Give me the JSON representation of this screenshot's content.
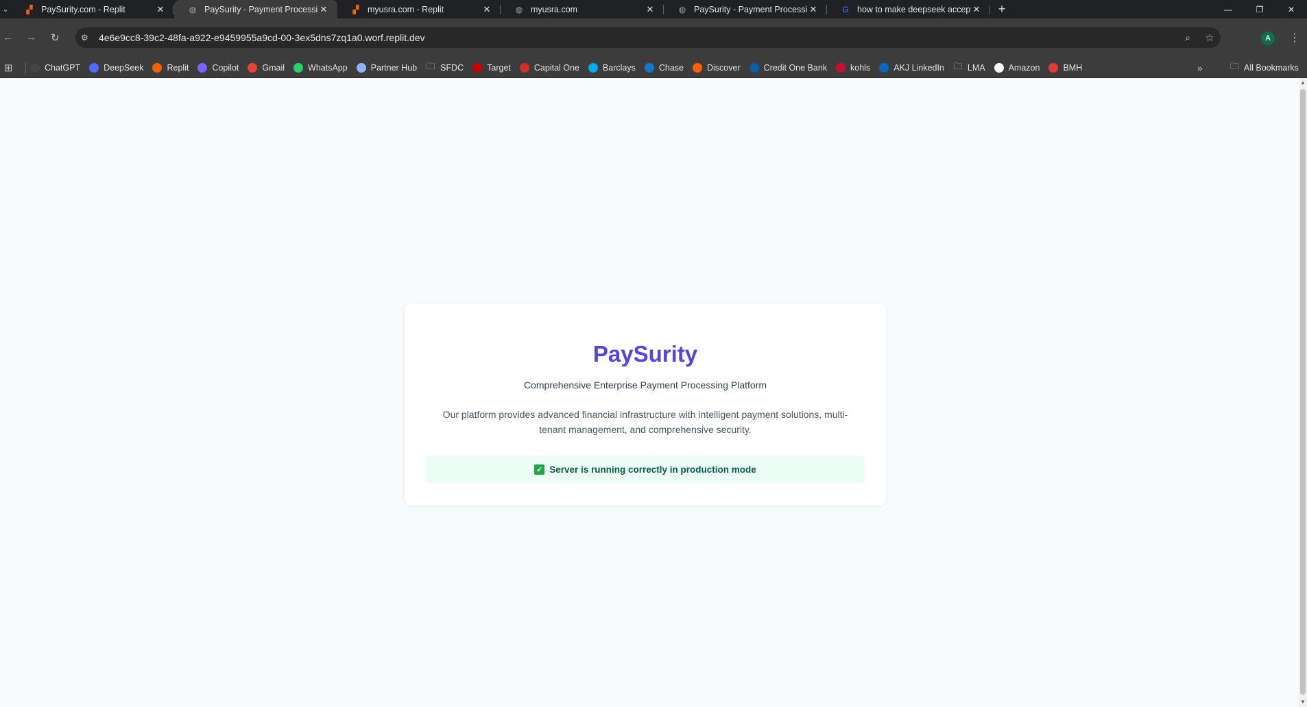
{
  "tabs": [
    {
      "title": "PaySurity.com - Replit",
      "icon": "replit-icon",
      "active": false
    },
    {
      "title": "PaySurity - Payment Processing",
      "icon": "globe-icon",
      "active": true
    },
    {
      "title": "myusra.com - Replit",
      "icon": "replit-icon",
      "active": false
    },
    {
      "title": "myusra.com",
      "icon": "globe-icon",
      "active": false
    },
    {
      "title": "PaySurity - Payment Processing",
      "icon": "globe-icon",
      "active": false
    },
    {
      "title": "how to make deepseek accept a",
      "icon": "google-icon",
      "active": false
    }
  ],
  "toolbar": {
    "url": "4e6e9cc8-39c2-48fa-a922-e9459955a9cd-00-3ex5dns7zq1a0.worf.replit.dev",
    "avatar_letter": "A"
  },
  "bookmarks": [
    {
      "label": "ChatGPT",
      "icon": "chatgpt-icon",
      "color": "#444444"
    },
    {
      "label": "DeepSeek",
      "icon": "deepseek-icon",
      "color": "#4d6bfe"
    },
    {
      "label": "Replit",
      "icon": "replit-icon",
      "color": "#f26207"
    },
    {
      "label": "Copilot",
      "icon": "copilot-icon",
      "color": "#7b61ff"
    },
    {
      "label": "Gmail",
      "icon": "gmail-icon",
      "color": "#ea4335"
    },
    {
      "label": "WhatsApp",
      "icon": "whatsapp-icon",
      "color": "#25d366"
    },
    {
      "label": "Partner Hub",
      "icon": "partner-hub-icon",
      "color": "#8ab4f8"
    },
    {
      "label": "SFDC",
      "icon": "folder-icon",
      "color": "#3c3c3c"
    },
    {
      "label": "Target",
      "icon": "target-icon",
      "color": "#cc0000"
    },
    {
      "label": "Capital One",
      "icon": "capital-one-icon",
      "color": "#d03027"
    },
    {
      "label": "Barclays",
      "icon": "barclays-icon",
      "color": "#00aeef"
    },
    {
      "label": "Chase",
      "icon": "chase-icon",
      "color": "#117aca"
    },
    {
      "label": "Discover",
      "icon": "discover-icon",
      "color": "#ff6000"
    },
    {
      "label": "Credit One Bank",
      "icon": "credit-one-icon",
      "color": "#0a5ea8"
    },
    {
      "label": "kohls",
      "icon": "kohls-icon",
      "color": "#c8102e"
    },
    {
      "label": "AKJ LinkedIn",
      "icon": "linkedin-icon",
      "color": "#0a66c2"
    },
    {
      "label": "LMA",
      "icon": "folder-icon",
      "color": "#3c3c3c"
    },
    {
      "label": "Amazon",
      "icon": "amazon-icon",
      "color": "#ffffff"
    },
    {
      "label": "BMH",
      "icon": "bmh-icon",
      "color": "#e53935"
    }
  ],
  "all_bookmarks_label": "All Bookmarks",
  "page": {
    "brand": "PaySurity",
    "subtitle": "Comprehensive Enterprise Payment Processing Platform",
    "description": "Our platform provides advanced financial infrastructure with intelligent payment solutions, multi-tenant management, and comprehensive security.",
    "status": "Server is running correctly in production mode"
  },
  "colors": {
    "brand": "#4f46e5",
    "status_bg": "#ecfdf5",
    "status_text": "#065f46",
    "check": "#22a447"
  }
}
